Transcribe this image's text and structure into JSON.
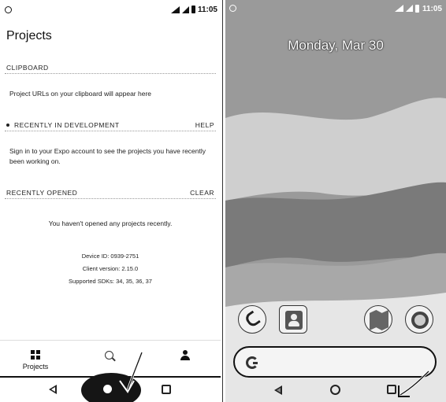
{
  "left_phone": {
    "status_bar": {
      "time": "11:05"
    },
    "title": "Projects",
    "clipboard": {
      "header": "CLIPBOARD",
      "body": "Project URLs on your clipboard will appear here"
    },
    "recent_dev": {
      "header": "RECENTLY IN DEVELOPMENT",
      "action": "HELP",
      "body": "Sign in to your Expo account to see the projects you have recently been working on."
    },
    "recent_opened": {
      "header": "RECENTLY OPENED",
      "action": "CLEAR",
      "body": "You haven't opened any projects recently."
    },
    "device_info": {
      "device_id": "Device ID: 0939-2751",
      "client_version": "Client version: 2.15.0",
      "supported_sdks": "Supported SDKs: 34, 35, 36, 37"
    },
    "bottom_nav": {
      "projects_label": "Projects"
    }
  },
  "right_phone": {
    "status_bar": {
      "time": "11:05"
    },
    "date": "Monday, Mar 30"
  },
  "colors": {
    "wallpaper": "#8a8a8a",
    "ink": "#111111",
    "background": "#ffffff"
  },
  "icons": {
    "projects_tab": "grid-icon",
    "search_tab": "search-icon",
    "profile_tab": "person-icon",
    "dock": [
      "phone-icon",
      "contacts-icon",
      "maps-icon",
      "chrome-icon"
    ],
    "search_bar": "google-g-icon"
  }
}
